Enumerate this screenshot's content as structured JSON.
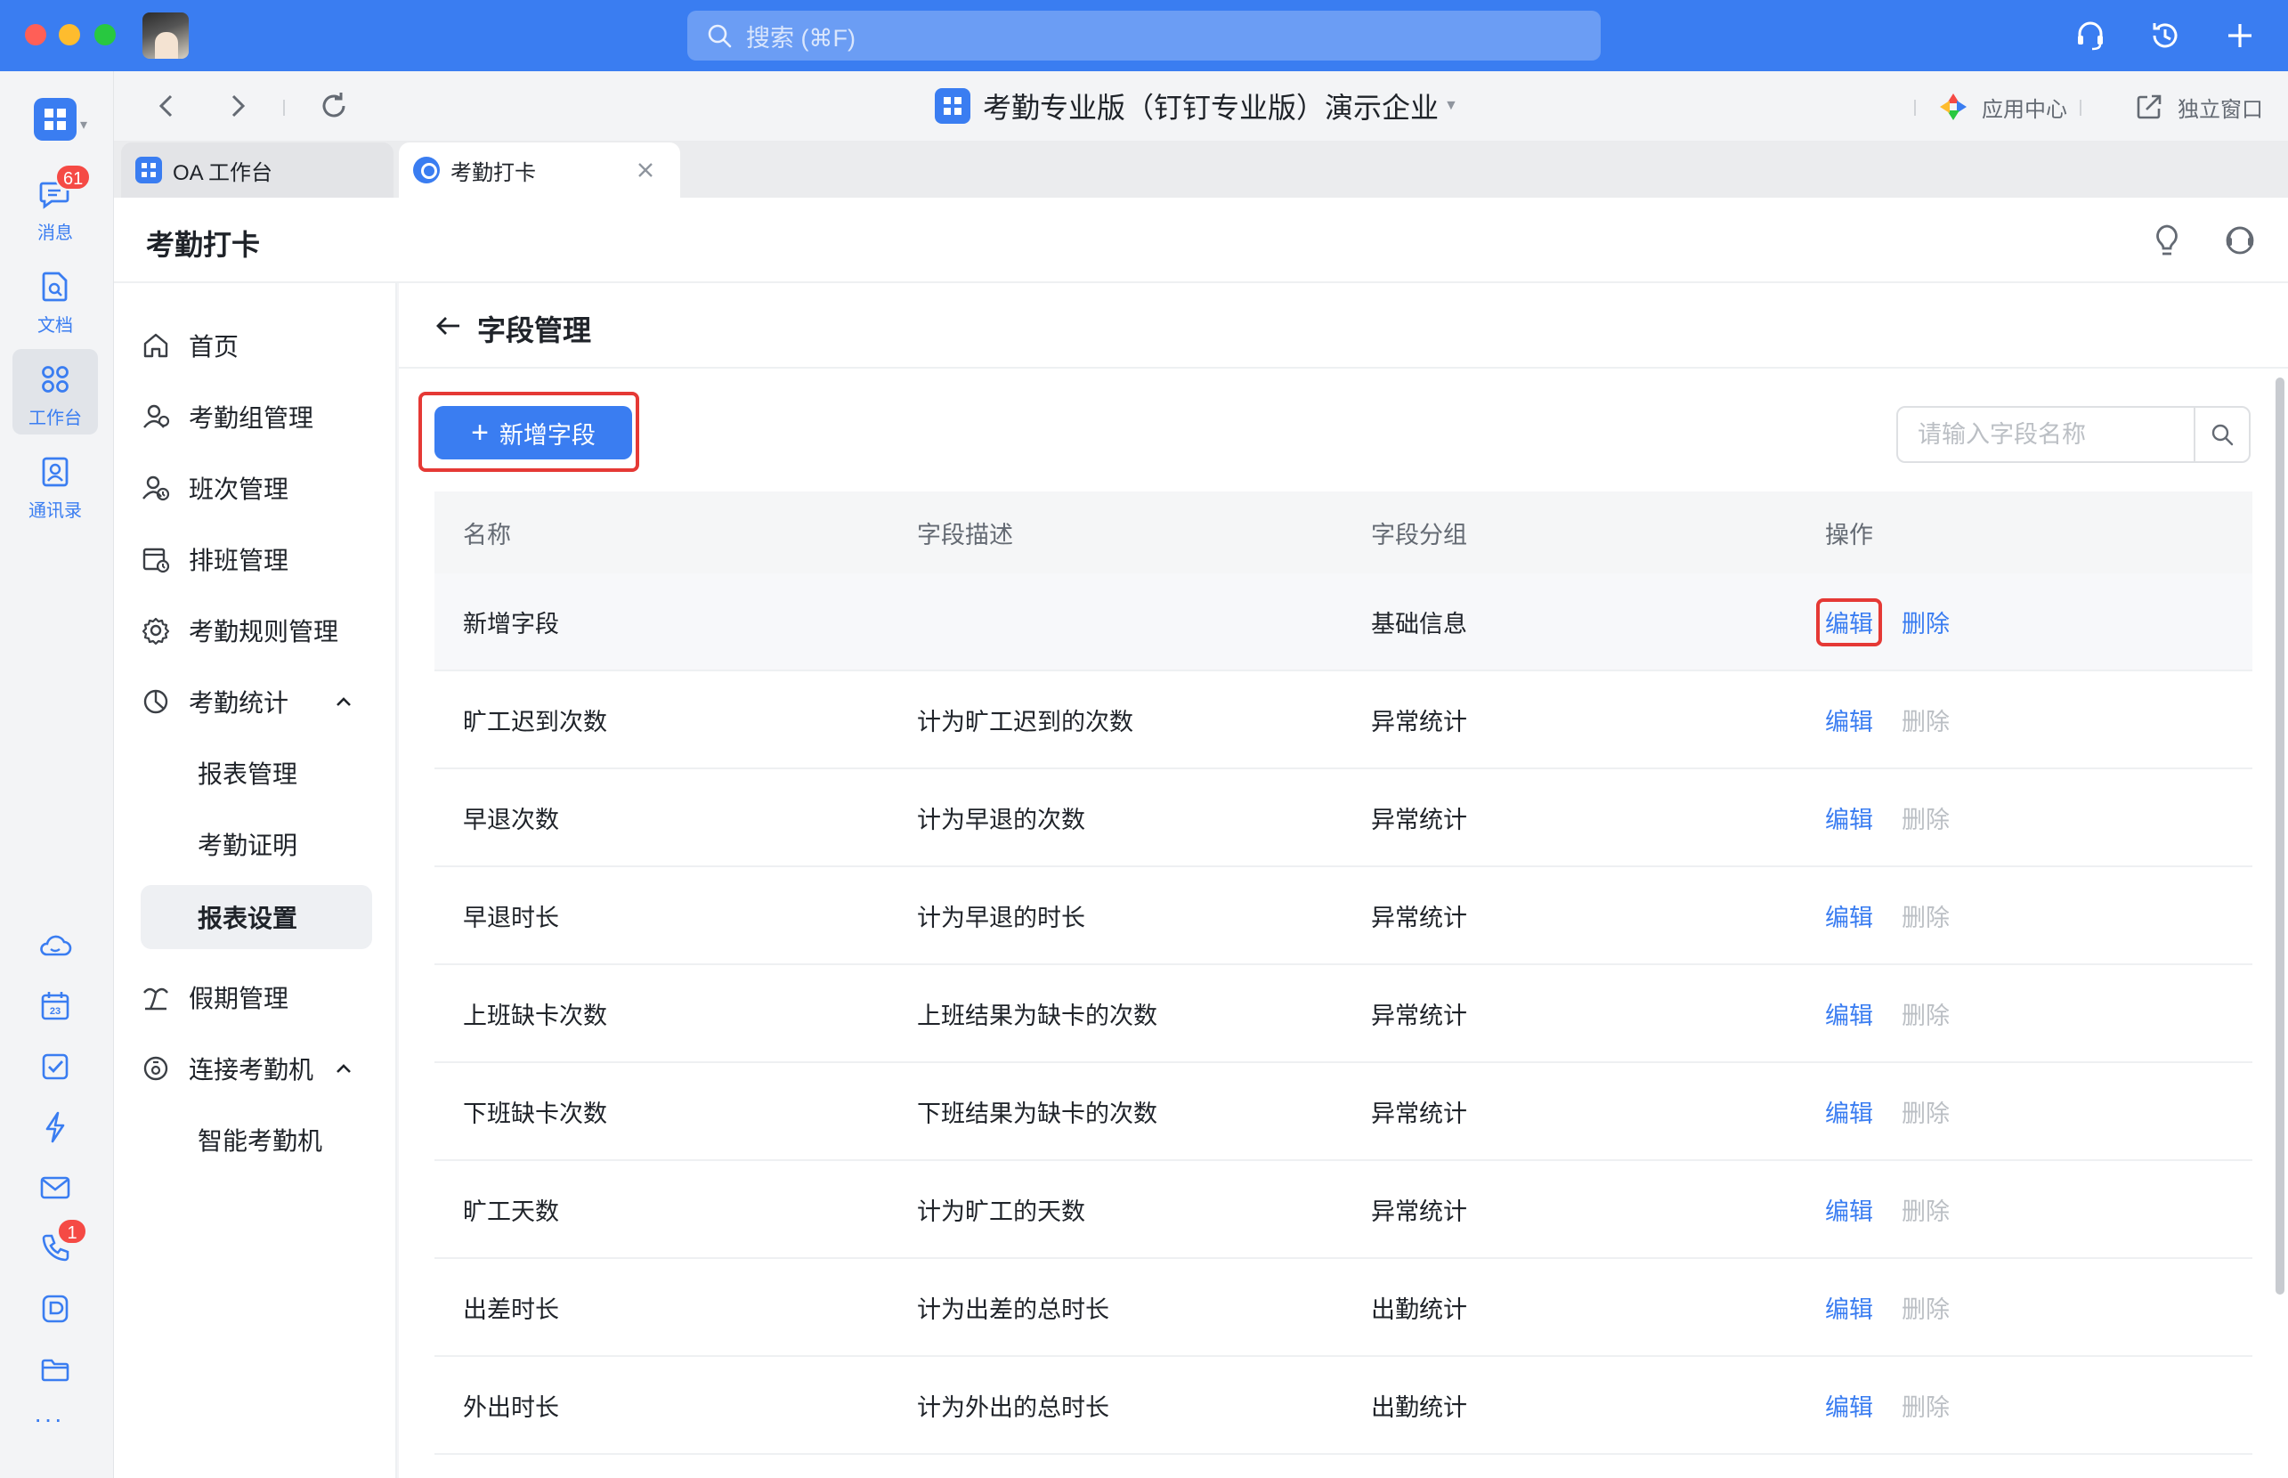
{
  "search": {
    "placeholder": "搜索 (⌘F)"
  },
  "rail": {
    "items": [
      {
        "label": "消息",
        "badge": "61"
      },
      {
        "label": "文档"
      },
      {
        "label": "工作台"
      },
      {
        "label": "通讯录"
      }
    ],
    "call_badge": "1",
    "more": "···"
  },
  "nav": {
    "org_title": "考勤专业版（钉钉专业版）演示企业",
    "app_center": "应用中心",
    "standalone": "独立窗口"
  },
  "tabs": [
    {
      "label": "OA 工作台"
    },
    {
      "label": "考勤打卡"
    }
  ],
  "app": {
    "title": "考勤打卡"
  },
  "menu": {
    "home": "首页",
    "group_mgmt": "考勤组管理",
    "shift_mgmt": "班次管理",
    "schedule_mgmt": "排班管理",
    "rule_mgmt": "考勤规则管理",
    "stats": "考勤统计",
    "stats_sub": [
      "报表管理",
      "考勤证明",
      "报表设置"
    ],
    "holiday_mgmt": "假期管理",
    "device": "连接考勤机",
    "device_sub": [
      "智能考勤机"
    ]
  },
  "page": {
    "title": "字段管理",
    "add_button": "新增字段",
    "search_placeholder": "请输入字段名称"
  },
  "table": {
    "headers": [
      "名称",
      "字段描述",
      "字段分组",
      "操作"
    ],
    "edit_label": "编辑",
    "delete_label": "删除",
    "rows": [
      {
        "name": "新增字段",
        "desc": "",
        "group": "基础信息"
      },
      {
        "name": "旷工迟到次数",
        "desc": "计为旷工迟到的次数",
        "group": "异常统计"
      },
      {
        "name": "早退次数",
        "desc": "计为早退的次数",
        "group": "异常统计"
      },
      {
        "name": "早退时长",
        "desc": "计为早退的时长",
        "group": "异常统计"
      },
      {
        "name": "上班缺卡次数",
        "desc": "上班结果为缺卡的次数",
        "group": "异常统计"
      },
      {
        "name": "下班缺卡次数",
        "desc": "下班结果为缺卡的次数",
        "group": "异常统计"
      },
      {
        "name": "旷工天数",
        "desc": "计为旷工的天数",
        "group": "异常统计"
      },
      {
        "name": "出差时长",
        "desc": "计为出差的总时长",
        "group": "出勤统计"
      },
      {
        "name": "外出时长",
        "desc": "计为外出的总时长",
        "group": "出勤统计"
      }
    ]
  },
  "colors": {
    "accent": "#3a7df1",
    "highlight": "#e53935",
    "badge": "#f54a45"
  }
}
